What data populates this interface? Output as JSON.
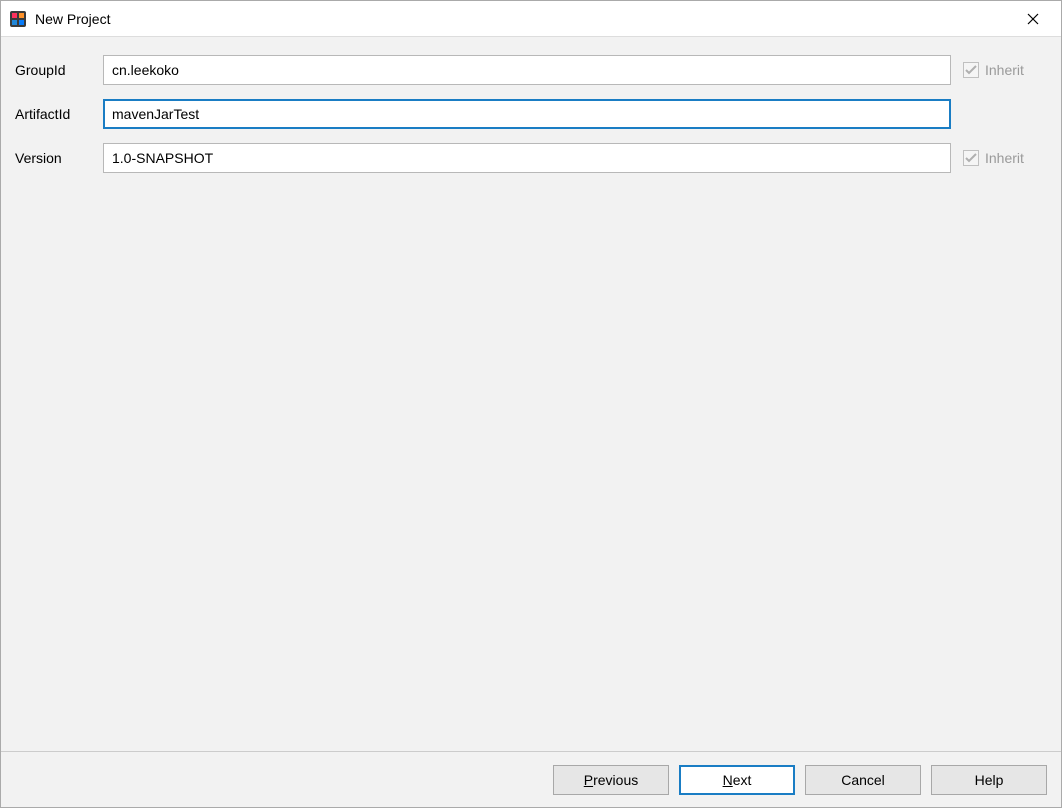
{
  "window": {
    "title": "New Project"
  },
  "form": {
    "groupId": {
      "label": "GroupId",
      "value": "cn.leekoko",
      "inherit_label": "Inherit",
      "inherit_checked": true
    },
    "artifactId": {
      "label": "ArtifactId",
      "value": "mavenJarTest"
    },
    "version": {
      "label": "Version",
      "value": "1.0-SNAPSHOT",
      "inherit_label": "Inherit",
      "inherit_checked": true
    }
  },
  "buttons": {
    "previous": {
      "mnemonic": "P",
      "rest": "revious"
    },
    "next": {
      "mnemonic": "N",
      "rest": "ext"
    },
    "cancel": {
      "label": "Cancel"
    },
    "help": {
      "label": "Help"
    }
  }
}
